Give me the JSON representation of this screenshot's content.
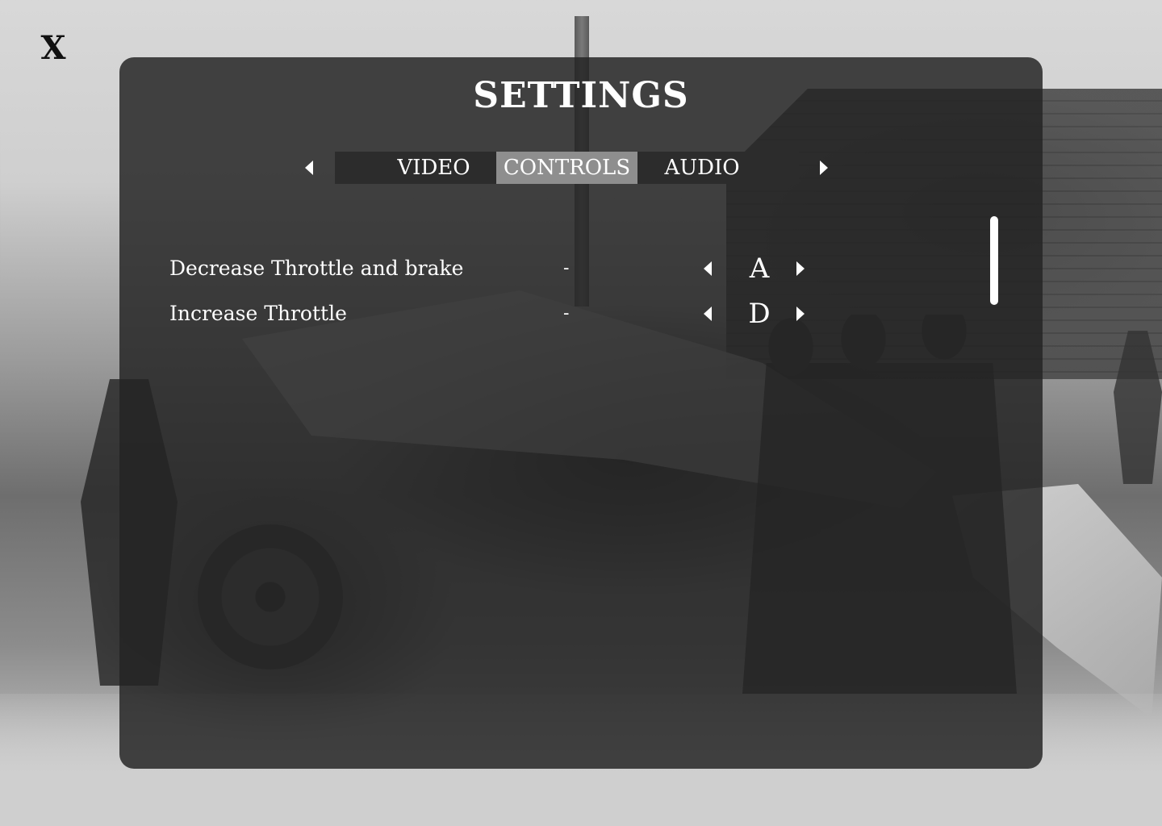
{
  "window": {
    "close_label": "X"
  },
  "settings": {
    "title": "SETTINGS",
    "tabs": [
      {
        "label": "VIDEO",
        "active": false
      },
      {
        "label": "CONTROLS",
        "active": true
      },
      {
        "label": "AUDIO",
        "active": false
      }
    ],
    "controls": [
      {
        "action": "Decrease Throttle and brake",
        "separator": "-",
        "key": "A"
      },
      {
        "action": "Increase Throttle",
        "separator": "-",
        "key": "D"
      }
    ]
  },
  "icons": {
    "close": "close-icon",
    "tab_prev": "triangle-left-icon",
    "tab_next": "triangle-right-icon",
    "key_prev": "triangle-left-icon",
    "key_next": "triangle-right-icon"
  },
  "colors": {
    "panel": "#242424",
    "tab_bar": "#2c2c2c",
    "tab_active": "#8e8e8e",
    "text": "#ffffff"
  }
}
